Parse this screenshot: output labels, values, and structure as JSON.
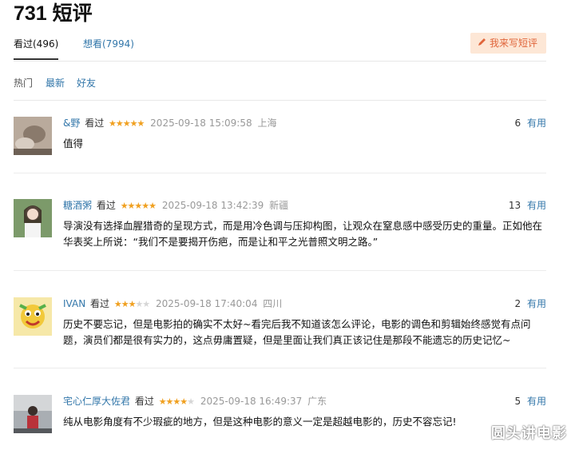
{
  "page": {
    "title": "731 短评"
  },
  "tabs": [
    {
      "label": "看过(496)"
    },
    {
      "label": "想看(7994)"
    }
  ],
  "write_button": {
    "label": "我来写短评",
    "icon": "pencil-icon"
  },
  "sorts": [
    {
      "label": "热门"
    },
    {
      "label": "最新"
    },
    {
      "label": "好友"
    }
  ],
  "comments": [
    {
      "user": "&野",
      "status": "看过",
      "rating": 5,
      "stars_text": "★★★★★",
      "stars_off": "",
      "time": "2025-09-18 15:09:58",
      "location": "上海",
      "votes": "6",
      "useful_label": "有用",
      "text": "值得"
    },
    {
      "user": "糖酒粥",
      "status": "看过",
      "rating": 5,
      "stars_text": "★★★★★",
      "stars_off": "",
      "time": "2025-09-18 13:42:39",
      "location": "新疆",
      "votes": "13",
      "useful_label": "有用",
      "text": "导演没有选择血腥猎奇的呈现方式，而是用冷色调与压抑构图，让观众在窒息感中感受历史的重量。正如他在华表奖上所说：“我们不是要揭开伤疤，而是让和平之光普照文明之路。”"
    },
    {
      "user": "IVAN",
      "status": "看过",
      "rating": 3,
      "stars_text": "★★★",
      "stars_off": "★★",
      "time": "2025-09-18 17:40:04",
      "location": "四川",
      "votes": "2",
      "useful_label": "有用",
      "text": "历史不要忘记，但是电影拍的确实不太好~看完后我不知道该怎么评论，电影的调色和剪辑始终感觉有点问题，演员们都是很有实力的，这点毋庸置疑，但是里面让我们真正该记住是那段不能遗忘的历史记忆~"
    },
    {
      "user": "宅心仁厚大佐君",
      "status": "看过",
      "rating": 4,
      "stars_text": "★★★★",
      "stars_off": "★",
      "time": "2025-09-18 16:49:37",
      "location": "广东",
      "votes": "5",
      "useful_label": "有用",
      "text": "纯从电影角度有不少瑕疵的地方，但是这种电影的意义一定是超越电影的，历史不容忘记!"
    }
  ],
  "watermark": "圆头讲电影",
  "colors": {
    "link": "#3377aa",
    "star": "#f0a020",
    "write_bg": "#fde7d6",
    "write_fg": "#e0653b"
  }
}
